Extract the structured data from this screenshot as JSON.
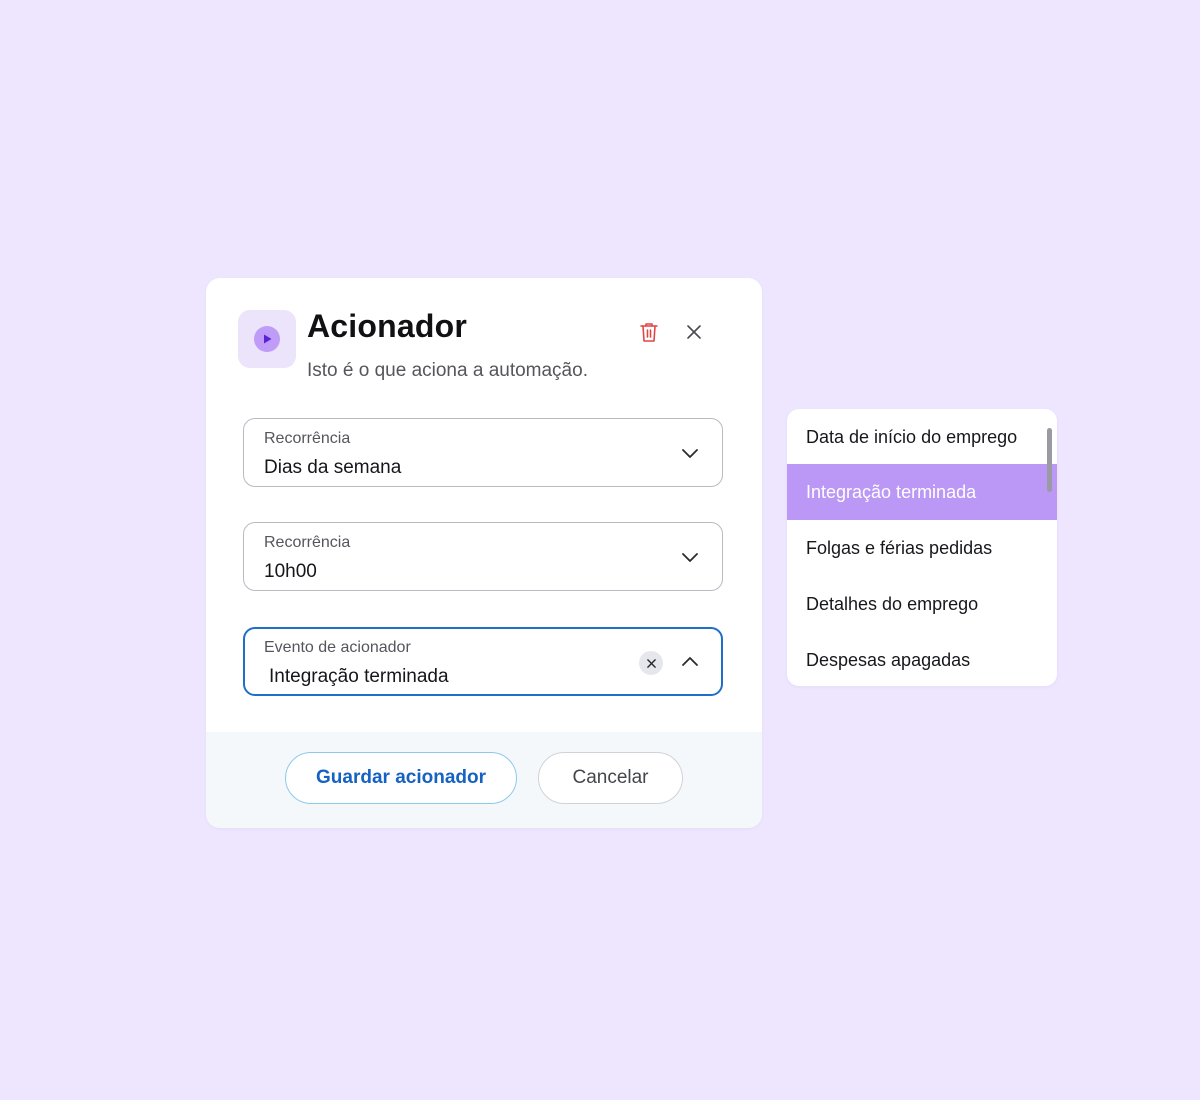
{
  "dialog": {
    "title": "Acionador",
    "subtitle": "Isto é o que aciona a automação.",
    "icon": "play-icon",
    "actions": {
      "delete_icon": "trash-icon",
      "close_icon": "close-icon"
    },
    "fields": [
      {
        "label": "Recorrência",
        "value": "Dias da semana",
        "state": "collapsed"
      },
      {
        "label": "Recorrência",
        "value": "10h00",
        "state": "collapsed"
      },
      {
        "label": "Evento de acionador",
        "value": "Integração terminada",
        "state": "expanded"
      }
    ],
    "footer": {
      "save_label": "Guardar acionador",
      "cancel_label": "Cancelar"
    }
  },
  "dropdown": {
    "options": [
      "Data de início do emprego",
      "Integração terminada",
      "Folgas e férias pedidas",
      "Detalhes do emprego",
      "Despesas apagadas"
    ],
    "selected": "Integração terminada"
  },
  "colors": {
    "background": "#EEE6FF",
    "accent_purple": "#BB98F6",
    "focus_blue": "#1F6FC8",
    "delete_red": "#E04545",
    "primary_text_blue": "#1662C3"
  }
}
